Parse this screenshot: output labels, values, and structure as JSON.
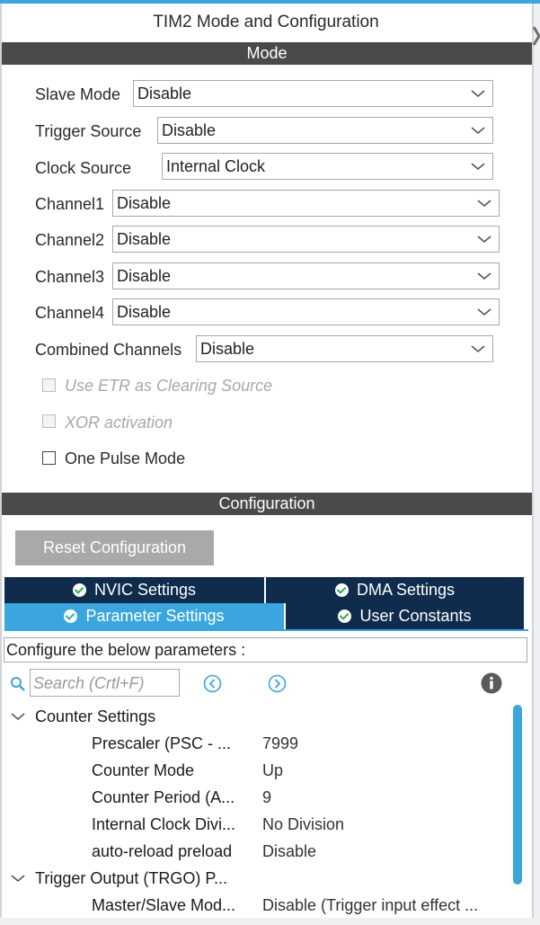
{
  "title": "TIM2 Mode and Configuration",
  "mode": {
    "header": "Mode",
    "fields": [
      {
        "label": "Slave Mode",
        "value": "Disable"
      },
      {
        "label": "Trigger Source",
        "value": "Disable"
      },
      {
        "label": "Clock Source",
        "value": "Internal Clock"
      },
      {
        "label": "Channel1",
        "value": "Disable"
      },
      {
        "label": "Channel2",
        "value": "Disable"
      },
      {
        "label": "Channel3",
        "value": "Disable"
      },
      {
        "label": "Channel4",
        "value": "Disable"
      },
      {
        "label": "Combined Channels",
        "value": "Disable"
      }
    ],
    "checkboxes": [
      {
        "label": "Use ETR as Clearing Source",
        "checked": false,
        "enabled": false
      },
      {
        "label": "XOR activation",
        "checked": false,
        "enabled": false
      },
      {
        "label": "One Pulse Mode",
        "checked": false,
        "enabled": true
      }
    ]
  },
  "configuration": {
    "header": "Configuration",
    "reset_label": "Reset Configuration",
    "tabs": [
      {
        "label": "NVIC Settings",
        "active": false
      },
      {
        "label": "DMA Settings",
        "active": false
      },
      {
        "label": "Parameter Settings",
        "active": true
      },
      {
        "label": "User Constants",
        "active": false
      }
    ],
    "instructions": "Configure the below parameters :",
    "search_placeholder": "Search (Crtl+F)",
    "tree": [
      {
        "group": "Counter Settings",
        "expanded": true,
        "items": [
          {
            "name": "Prescaler (PSC - ...",
            "value": "7999"
          },
          {
            "name": "Counter Mode",
            "value": "Up"
          },
          {
            "name": "Counter Period (A...",
            "value": "9"
          },
          {
            "name": "Internal Clock Divi...",
            "value": "No Division"
          },
          {
            "name": "auto-reload preload",
            "value": "Disable"
          }
        ]
      },
      {
        "group": "Trigger Output (TRGO) P...",
        "expanded": true,
        "items": [
          {
            "name": "Master/Slave Mod...",
            "value": "Disable (Trigger input effect ..."
          }
        ]
      }
    ]
  },
  "colors": {
    "accent": "#3aa6dd",
    "tab_dark": "#0f2c4d",
    "header_dark": "#4a4a4a",
    "check_green": "#3aa94a"
  },
  "icons": [
    "chevron-down-icon",
    "check-circle-icon",
    "search-icon",
    "prev-arrow-icon",
    "next-arrow-icon",
    "info-icon",
    "chevron-expand-icon"
  ]
}
